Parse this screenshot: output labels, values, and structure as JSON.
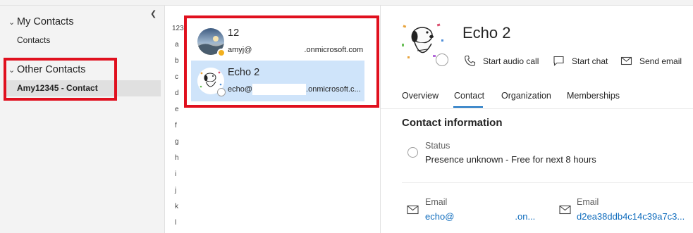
{
  "folders": {
    "collapse_icon": "chevron-left-icon",
    "my_contacts": {
      "label": "My Contacts",
      "children": [
        "Contacts"
      ]
    },
    "other_contacts": {
      "label": "Other Contacts",
      "children": [
        "Amy12345 - Contact"
      ]
    }
  },
  "alphabet": [
    "123",
    "a",
    "b",
    "c",
    "d",
    "e",
    "f",
    "g",
    "h",
    "i",
    "j",
    "k",
    "l"
  ],
  "contacts": [
    {
      "name": "12",
      "email_prefix": "amyj@",
      "email_suffix": ".onmicrosoft.com",
      "presence_color": "#f2b01e"
    },
    {
      "name": "Echo 2",
      "email_prefix": "echo@",
      "email_suffix": ".onmicrosoft.c...",
      "presence_color": "#ffffff"
    }
  ],
  "detail": {
    "name": "Echo 2",
    "actions": [
      "Start audio call",
      "Start chat",
      "Send email"
    ],
    "tabs": [
      "Overview",
      "Contact",
      "Organization",
      "Memberships"
    ],
    "active_tab": "Contact",
    "section_title": "Contact information",
    "status_label": "Status",
    "status_value": "Presence unknown - Free for next 8 hours",
    "email_fields": [
      {
        "label": "Email",
        "prefix": "echo@",
        "suffix": ".on..."
      },
      {
        "label": "Email",
        "value": "d2ea38ddb4c14c39a7c3..."
      }
    ]
  },
  "colors": {
    "accent": "#0f6cbd",
    "selection": "#cfe4fa",
    "highlight": "#e0101e"
  }
}
